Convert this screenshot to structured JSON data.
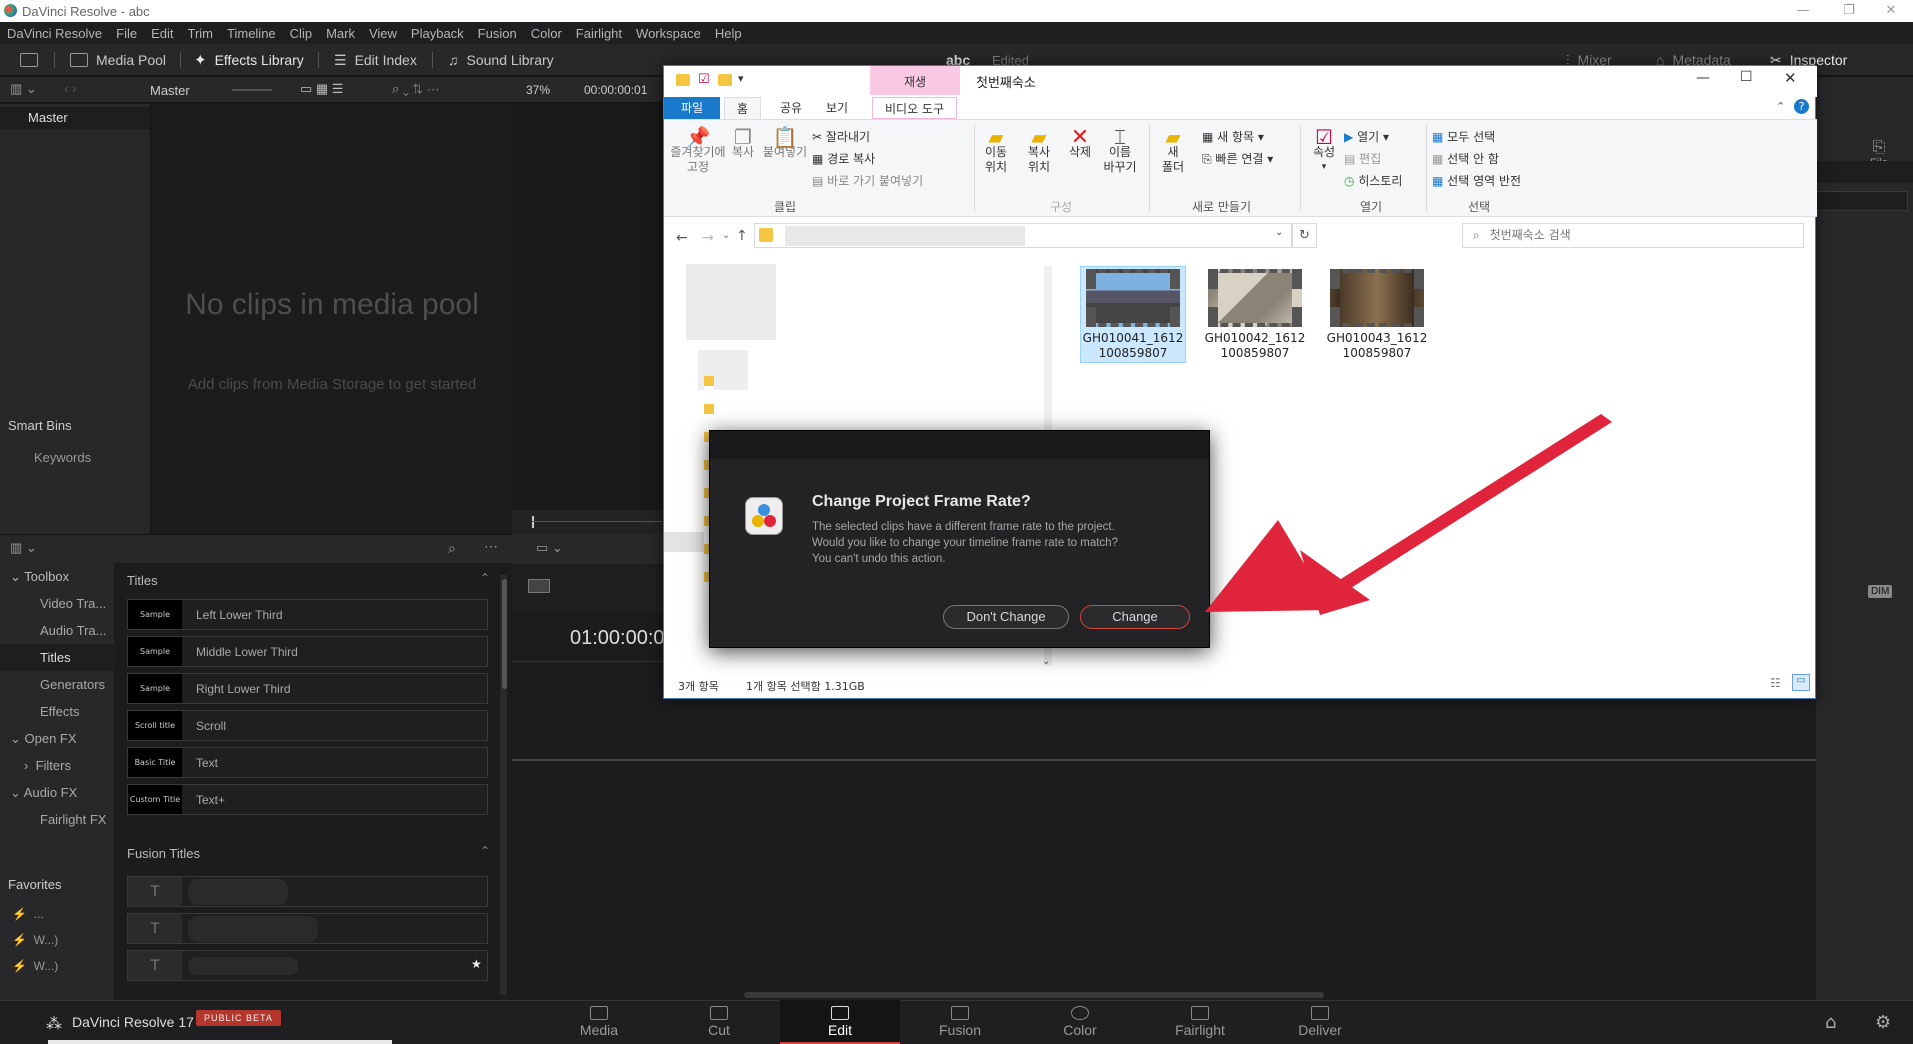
{
  "window": {
    "title": "DaVinci Resolve - abc",
    "min": "—",
    "max": "❐",
    "close": "✕"
  },
  "menu": [
    "DaVinci Resolve",
    "File",
    "Edit",
    "Trim",
    "Timeline",
    "Clip",
    "Mark",
    "View",
    "Playback",
    "Fusion",
    "Color",
    "Fairlight",
    "Workspace",
    "Help"
  ],
  "toolbar": {
    "media_pool": "Media Pool",
    "effects_library": "Effects Library",
    "edit_index": "Edit Index",
    "sound_library": "Sound Library",
    "project_name": "abc",
    "project_status": "Edited",
    "mixer": "Mixer",
    "metadata": "Metadata",
    "inspector": "Inspector"
  },
  "media_pool": {
    "bin_label": "Master",
    "master": "Master",
    "empty_title": "No clips in media pool",
    "empty_hint": "Add clips from Media Storage to get started",
    "smart_bins": "Smart Bins",
    "keywords": "Keywords"
  },
  "viewer": {
    "zoom": "37%",
    "timecode": "00:00:00:01",
    "timeline_tc": "01:00:00:0"
  },
  "toolbox": {
    "items": [
      "Toolbox",
      "Video Tra...",
      "Audio Tra...",
      "Titles",
      "Generators",
      "Effects",
      "Open FX",
      "Filters",
      "Audio FX",
      "Fairlight FX"
    ],
    "favorites": "Favorites",
    "fav_items": [
      "...",
      "W...)",
      "W...)"
    ]
  },
  "titles": {
    "header": "Titles",
    "items": [
      {
        "thumb": "Sample",
        "name": "Left Lower Third"
      },
      {
        "thumb": "Sample",
        "name": "Middle Lower Third"
      },
      {
        "thumb": "Sample",
        "name": "Right Lower Third"
      },
      {
        "thumb": "Scroll title",
        "name": "Scroll"
      },
      {
        "thumb": "Basic Title",
        "name": "Text"
      },
      {
        "thumb": "Custom Title",
        "name": "Text+"
      }
    ],
    "fusion_header": "Fusion Titles"
  },
  "right_panel": {
    "file": "File",
    "dim": "DIM"
  },
  "pages": [
    "Media",
    "Cut",
    "Edit",
    "Fusion",
    "Color",
    "Fairlight",
    "Deliver"
  ],
  "active_page": "Edit",
  "brand": {
    "name": "DaVinci Resolve 17",
    "badge": "PUBLIC BETA"
  },
  "explorer": {
    "title": "첫번째숙소",
    "context_tab": "재생",
    "tabs": [
      "파일",
      "홈",
      "공유",
      "보기",
      "비디오 도구"
    ],
    "ribbon": {
      "pin": "즐겨찾기에\n고정",
      "copy": "복사",
      "paste": "붙여넣기",
      "cut": "잘라내기",
      "copy_path": "경로 복사",
      "paste_shortcut": "바로 가기 붙여넣기",
      "move_to": "이동\n위치",
      "copy_to": "복사\n위치",
      "delete": "삭제",
      "rename": "이름\n바꾸기",
      "new_folder": "새\n폴더",
      "new_item": "새 항목",
      "easy_access": "빠른 연결",
      "properties": "속성",
      "open": "열기",
      "edit": "편집",
      "history": "히스토리",
      "select_all": "모두 선택",
      "select_none": "선택 안 함",
      "invert": "선택 영역 반전",
      "grp_clipboard": "클립",
      "grp_organize": "구성",
      "grp_new": "새로 만들기",
      "grp_open": "열기",
      "grp_select": "선택"
    },
    "search_placeholder": "첫번째숙소 검색",
    "files": [
      {
        "name": "GH010041_1612100859807",
        "line1": "GH010041_1612",
        "line2": "100859807",
        "selected": true
      },
      {
        "name": "GH010042_1612100859807",
        "line1": "GH010042_1612",
        "line2": "100859807",
        "selected": false
      },
      {
        "name": "GH010043_1612100859807",
        "line1": "GH010043_1612",
        "line2": "100859807",
        "selected": false
      }
    ],
    "status_count": "3개 항목",
    "status_selected": "1개 항목 선택함 1.31GB"
  },
  "dialog": {
    "title": "Change Project Frame Rate?",
    "message": "The selected clips have a different frame rate to the project. Would you like to change your timeline frame rate to match? You can't undo this action.",
    "dont_change": "Don't Change",
    "change": "Change"
  },
  "colors": {
    "accent_red": "#e0243c",
    "explorer_blue": "#1979ca",
    "active_page": "#d0443a"
  }
}
